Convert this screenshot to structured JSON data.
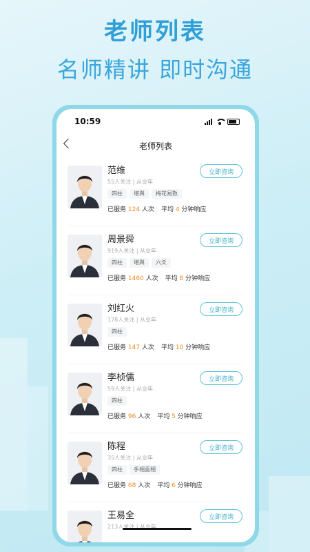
{
  "promo": {
    "title": "老师列表",
    "subtitle": "名师精讲 即时沟通"
  },
  "status": {
    "time": "10:59"
  },
  "nav": {
    "title": "老师列表"
  },
  "teachers": [
    {
      "name": "范维",
      "followers": "55人关注",
      "since": "从业年",
      "tags": [
        "四柱",
        "堪舆",
        "梅花易数"
      ],
      "served_prefix": "已服务",
      "served": "124",
      "served_suffix": "人次",
      "avg_prefix": "平均",
      "avg": "4",
      "avg_suffix": "分钟响应",
      "button": "立即咨询"
    },
    {
      "name": "周景舜",
      "followers": "919人关注",
      "since": "从业年",
      "tags": [
        "四柱",
        "堪舆",
        "六爻"
      ],
      "served_prefix": "已服务",
      "served": "1460",
      "served_suffix": "人次",
      "avg_prefix": "平均",
      "avg": "8",
      "avg_suffix": "分钟响应",
      "button": "立即咨询"
    },
    {
      "name": "刘红火",
      "followers": "178人关注",
      "since": "从业年",
      "tags": [
        "四柱"
      ],
      "served_prefix": "已服务",
      "served": "147",
      "served_suffix": "人次",
      "avg_prefix": "平均",
      "avg": "10",
      "avg_suffix": "分钟响应",
      "button": "立即咨询"
    },
    {
      "name": "李桢儒",
      "followers": "59人关注",
      "since": "从业年",
      "tags": [
        "四柱"
      ],
      "served_prefix": "已服务",
      "served": "96",
      "served_suffix": "人次",
      "avg_prefix": "平均",
      "avg": "5",
      "avg_suffix": "分钟响应",
      "button": "立即咨询"
    },
    {
      "name": "陈程",
      "followers": "35人关注",
      "since": "从业年",
      "tags": [
        "四柱",
        "手相面相"
      ],
      "served_prefix": "已服务",
      "served": "68",
      "served_suffix": "人次",
      "avg_prefix": "平均",
      "avg": "6",
      "avg_suffix": "分钟响应",
      "button": "立即咨询"
    },
    {
      "name": "王易全",
      "followers": "213人关注",
      "since": "从业年",
      "tags": [],
      "served_prefix": "",
      "served": "",
      "served_suffix": "",
      "avg_prefix": "",
      "avg": "",
      "avg_suffix": "",
      "button": "立即咨询"
    }
  ],
  "colors": {
    "accent": "#3fb0c6",
    "highlight": "#f08a24",
    "headline": "#2f9fd6"
  }
}
